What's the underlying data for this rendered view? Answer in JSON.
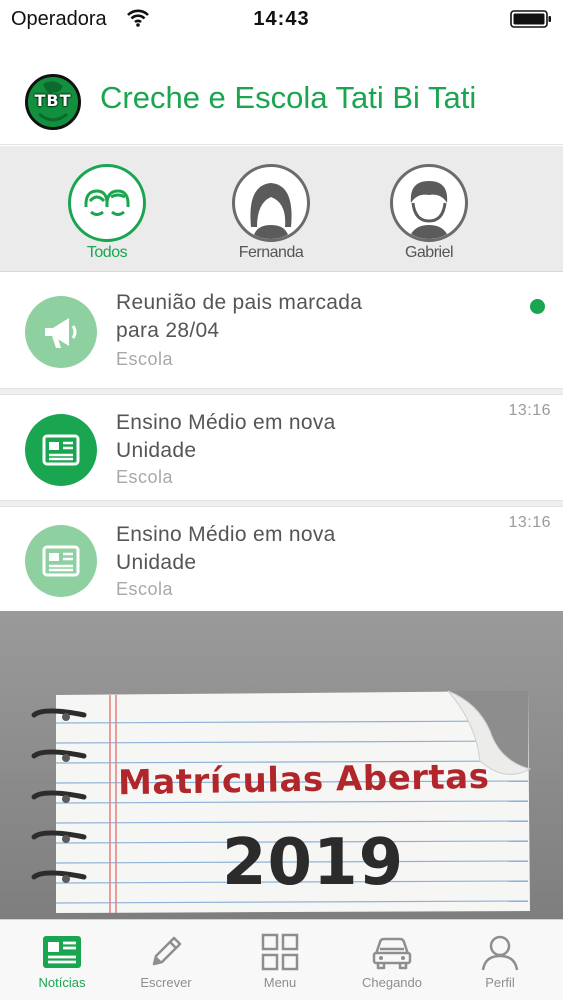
{
  "status_bar": {
    "carrier": "Operadora",
    "time": "14:43"
  },
  "header": {
    "logo_text": "TBT",
    "title": "Creche e Escola Tati Bi Tati"
  },
  "profiles": [
    {
      "label": "Todos",
      "icon": "two-children-icon",
      "active": true
    },
    {
      "label": "Fernanda",
      "icon": "girl-avatar-icon",
      "active": false
    },
    {
      "label": "Gabriel",
      "icon": "boy-avatar-icon",
      "active": false
    }
  ],
  "news": [
    {
      "title_line1": "Reunião de pais marcada",
      "title_line2": "para 28/04",
      "source": "Escola",
      "time": "",
      "icon": "megaphone-icon",
      "unread": true
    },
    {
      "title_line1": "Ensino Médio em nova",
      "title_line2": "Unidade",
      "source": "Escola",
      "time": "13:16",
      "icon": "newspaper-icon",
      "unread": false
    },
    {
      "title_line1": "Ensino Médio em nova",
      "title_line2": "Unidade",
      "source": "Escola",
      "time": "13:16",
      "icon": "newspaper-icon",
      "unread": false
    }
  ],
  "banner": {
    "title": "Matrículas Abertas",
    "year": "2019"
  },
  "tabs": [
    {
      "label": "Notícias",
      "icon": "news-icon",
      "active": true
    },
    {
      "label": "Escrever",
      "icon": "pencil-icon",
      "active": false
    },
    {
      "label": "Menu",
      "icon": "grid-icon",
      "active": false
    },
    {
      "label": "Chegando",
      "icon": "car-icon",
      "active": false
    },
    {
      "label": "Perfil",
      "icon": "person-icon",
      "active": false
    }
  ],
  "colors": {
    "accent": "#1aa550",
    "accent_light": "#8fd0a0",
    "inactive": "#8e8e8e",
    "banner_red": "#b0262b"
  }
}
